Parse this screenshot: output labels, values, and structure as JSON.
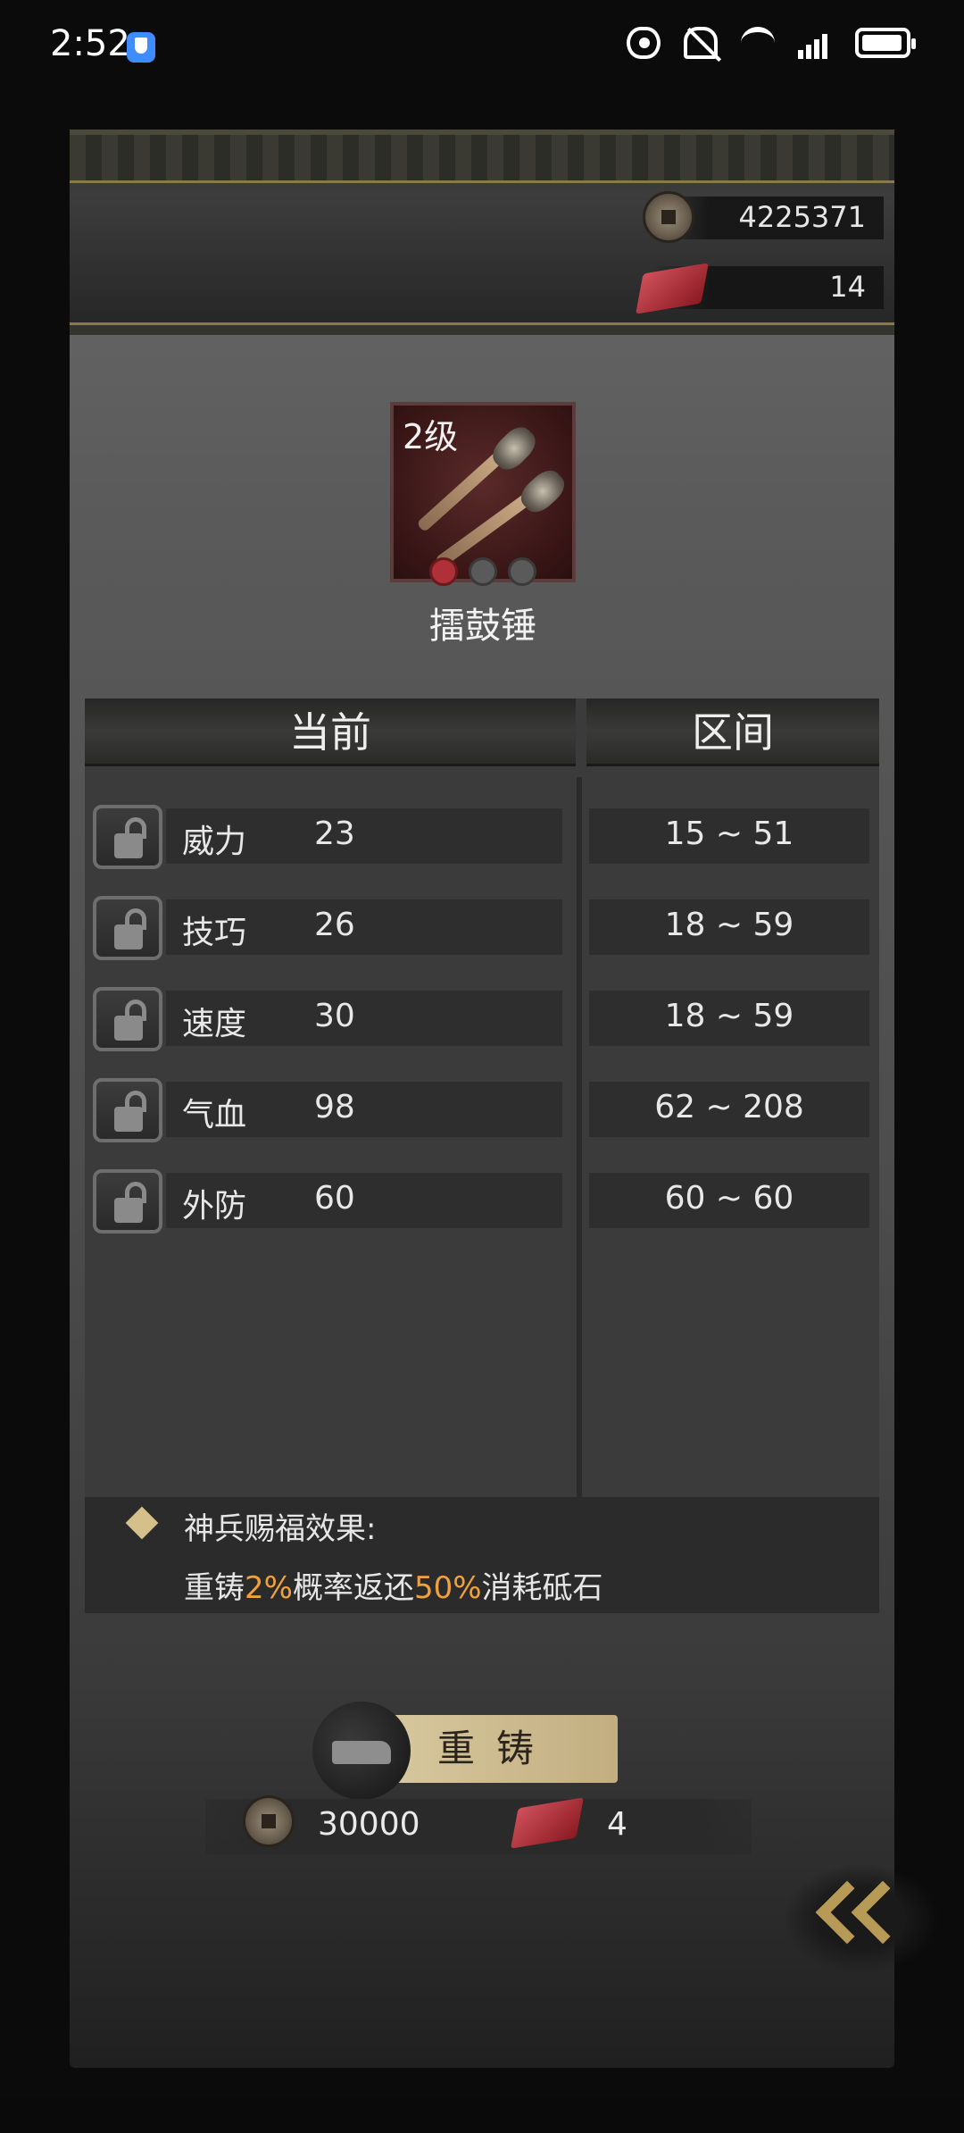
{
  "status_bar": {
    "time": "2:52",
    "icons": [
      "shield-icon",
      "eye-icon",
      "bell-off-icon",
      "wifi-icon",
      "signal-5g-icon",
      "battery-icon"
    ]
  },
  "currency": {
    "coins": "4225371",
    "gems": "14"
  },
  "item": {
    "level": "2级",
    "name": "擂鼓锤",
    "slots_active": 1,
    "slots_total": 3
  },
  "table": {
    "header_current": "当前",
    "header_range": "区间",
    "rows": [
      {
        "name": "威力",
        "value": "23",
        "range": "15 ~ 51"
      },
      {
        "name": "技巧",
        "value": "26",
        "range": "18 ~ 59"
      },
      {
        "name": "速度",
        "value": "30",
        "range": "18 ~ 59"
      },
      {
        "name": "气血",
        "value": "98",
        "range": "62 ~ 208"
      },
      {
        "name": "外防",
        "value": "60",
        "range": "60 ~ 60"
      }
    ]
  },
  "blessing": {
    "title": "神兵赐福效果:",
    "part1": "重铸",
    "pct1": "2%",
    "part2": "概率返还",
    "pct2": "50%",
    "part3": "消耗砥石"
  },
  "reforge": {
    "label": "重铸",
    "cost_coins": "30000",
    "cost_gems": "4"
  },
  "colors": {
    "highlight": "#f0a23a",
    "gold": "#b79a56"
  }
}
